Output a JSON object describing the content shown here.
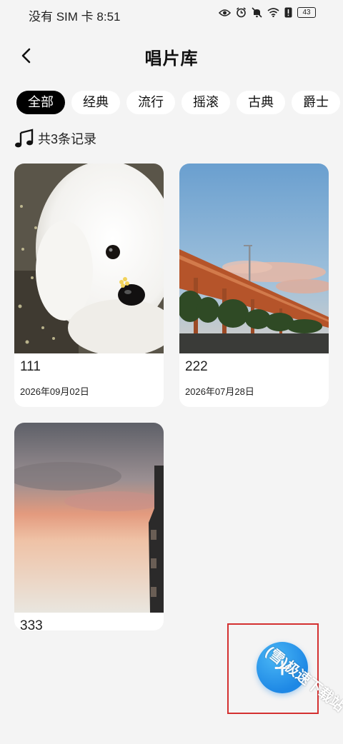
{
  "status_bar": {
    "carrier": "没有 SIM 卡",
    "time": "8:51",
    "battery": "43"
  },
  "header": {
    "title": "唱片库"
  },
  "tabs": [
    {
      "label": "全部",
      "active": true
    },
    {
      "label": "经典",
      "active": false
    },
    {
      "label": "流行",
      "active": false
    },
    {
      "label": "摇滚",
      "active": false
    },
    {
      "label": "古典",
      "active": false
    },
    {
      "label": "爵士",
      "active": false
    }
  ],
  "record_count": "共3条记录",
  "records": [
    {
      "title": "111",
      "date": "2026年09月02日",
      "image": "white-poodle-photo"
    },
    {
      "title": "222",
      "date": "2026年07月28日",
      "image": "bridge-sky-photo"
    },
    {
      "title": "333",
      "date": "",
      "image": "sunset-sky-photo"
    }
  ],
  "fab": {
    "icon": "plus-icon"
  },
  "watermark": "(雪)极速下载站",
  "colors": {
    "background": "#f4f4f4",
    "active_tab": "#000000",
    "fab": "#1e88e5",
    "highlight": "#d43030"
  }
}
